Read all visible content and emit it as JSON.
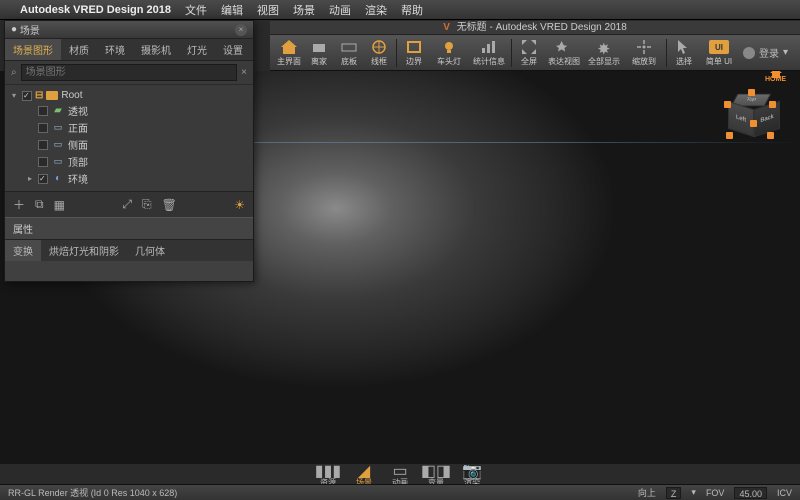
{
  "menubar": {
    "app_title": "Autodesk VRED Design 2018",
    "items": [
      "文件",
      "编辑",
      "视图",
      "场景",
      "动画",
      "渲染",
      "帮助"
    ]
  },
  "doc": {
    "prefix": "V",
    "title": "无标题 - Autodesk VRED Design 2018"
  },
  "toolbar": {
    "items": [
      {
        "label": "主界面"
      },
      {
        "label": "离家"
      },
      {
        "label": "底板"
      },
      {
        "label": "线框"
      },
      {
        "label": "边界"
      },
      {
        "label": "车头灯"
      },
      {
        "label": "统计信息"
      },
      {
        "label": "全屏"
      },
      {
        "label": "表达视图"
      },
      {
        "label": "全部显示"
      },
      {
        "label": "缩放到"
      },
      {
        "label": "选择"
      },
      {
        "label": "简单 UI"
      }
    ],
    "login": "登录"
  },
  "panel": {
    "title": "场景",
    "tabs": [
      "场景图形",
      "材质",
      "环境",
      "摄影机",
      "灯光",
      "设置"
    ],
    "search_placeholder": "场景图形",
    "tree": [
      {
        "label": "Root",
        "icon": "folder",
        "expanded": true,
        "checked": true
      },
      {
        "label": "透视",
        "icon": "cam",
        "child": true
      },
      {
        "label": "正面",
        "icon": "view",
        "child": true
      },
      {
        "label": "侧面",
        "icon": "view",
        "child": true
      },
      {
        "label": "顶部",
        "icon": "view",
        "child": true
      },
      {
        "label": "环境",
        "icon": "env",
        "child": true,
        "expandable": true
      }
    ],
    "props_title": "属性",
    "props_tabs": [
      "变换",
      "烘焙灯光和阴影",
      "几何体"
    ]
  },
  "viewcube": {
    "home": "HOME",
    "faces": {
      "top": "Top",
      "front": "Left",
      "right": "Back"
    }
  },
  "bottom": {
    "items": [
      {
        "label": "资源"
      },
      {
        "label": "场景",
        "active": true
      },
      {
        "label": "动画"
      },
      {
        "label": "变量"
      },
      {
        "label": "渲染"
      }
    ]
  },
  "status": {
    "left": "RR-GL  Render 透视 (Id 0 Res 1040 x 628)",
    "up": "向上",
    "axis": "Z",
    "fov_label": "FOV",
    "fov": "45.00",
    "icv": "ICV"
  }
}
